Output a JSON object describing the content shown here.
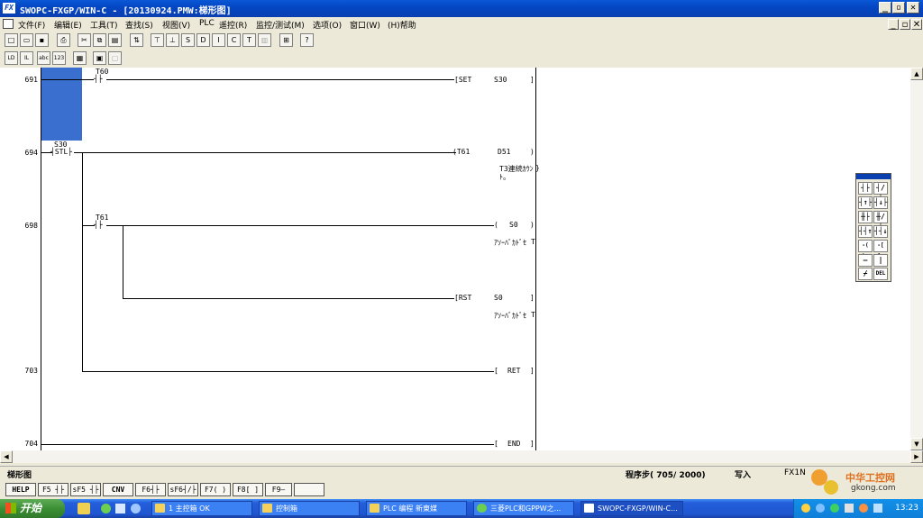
{
  "window": {
    "title": "SWOPC-FXGP/WIN-C - [20130924.PMW:梯形图]"
  },
  "menu": [
    "文件(F)",
    "编辑(E)",
    "工具(T)",
    "查找(S)",
    "视图(V)",
    "PLC",
    "遥控(R)",
    "监控/测试(M)",
    "选项(O)",
    "窗口(W)",
    "(H)帮助"
  ],
  "ladder": {
    "rungs": [
      {
        "step": "691",
        "contact": "T60",
        "instr": "[SET",
        "operand": "S30",
        "close": "]"
      },
      {
        "step": "694",
        "contact": "S30",
        "stl": "STL",
        "instr": "(T61",
        "operand": "D51",
        "close": ")",
        "comment1": "T3連続ｶｳﾝ",
        "comment2": "ﾄ。",
        "extra": "}"
      },
      {
        "step": "698",
        "contact": "T61",
        "instr": "(",
        "operand": "S0",
        "close": ")",
        "comment1": "ｱｿｰﾊﾞｶﾄﾞｾ",
        "extra": "T"
      },
      {
        "step": "",
        "instr": "[RST",
        "operand": "S0",
        "close": "]",
        "comment1": "ｱｿｰﾊﾞｶﾄﾞｾ",
        "extra": "T"
      },
      {
        "step": "703",
        "instr": "[",
        "operand": "RET",
        "close": "]"
      },
      {
        "step": "704",
        "instr": "[",
        "operand": "END",
        "close": "]"
      }
    ]
  },
  "palette": [
    "┤├",
    "┤/├",
    "┤↑├",
    "┤↓├",
    "╫├",
    "╫/├",
    "┤┤↑",
    "┤┤↓",
    "-( )-",
    "-[ ]-",
    "—",
    "|",
    "⌿",
    "DEL"
  ],
  "status": {
    "mode": "梯形图",
    "steps": "程序步( 705/ 2000)",
    "insert": "写入",
    "plc": "FX1N"
  },
  "fkeys": [
    "HELP",
    "F5 ┤├",
    "sF5 ┤├",
    "CNV",
    "F6┤├",
    "sF6┤/├",
    "F7( )",
    "F8[ ]",
    "F9—",
    ""
  ],
  "taskbar": {
    "start": "开始",
    "tasks": [
      "1 主控箱 OK",
      "控制箱",
      "PLC 编程 新東媒",
      "三菱PLC和GPPW之...",
      "SWOPC-FXGP/WIN-C..."
    ],
    "clock": "13:23"
  },
  "watermark": {
    "line1": "中华工控网",
    "line2": "gkong.com"
  }
}
